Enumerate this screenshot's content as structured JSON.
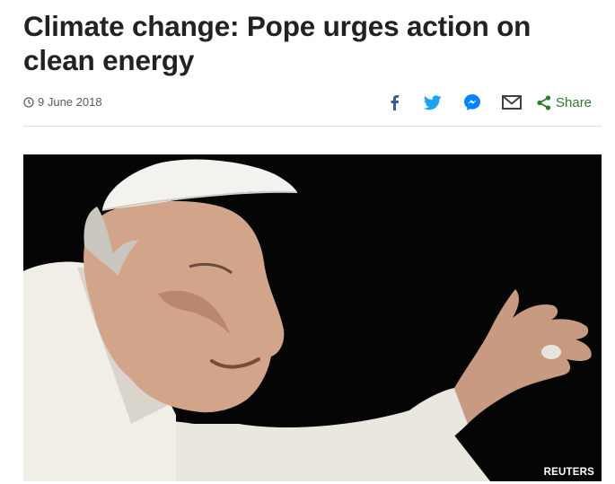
{
  "article": {
    "headline": "Climate change: Pope urges action on clean energy",
    "date": "9 June 2018"
  },
  "share": {
    "label": "Share",
    "facebook_icon": "facebook-icon",
    "twitter_icon": "twitter-icon",
    "messenger_icon": "messenger-icon",
    "email_icon": "email-icon",
    "share_icon": "share-icon",
    "colors": {
      "facebook": "#3b5998",
      "twitter": "#1da1f2",
      "messenger": "#0084ff",
      "email": "#404040",
      "share": "#2c7a2c"
    }
  },
  "image": {
    "credit": "REUTERS"
  }
}
